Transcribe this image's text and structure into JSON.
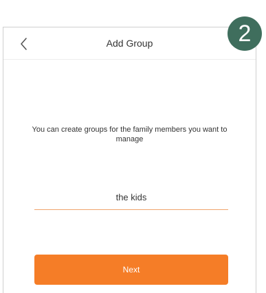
{
  "header": {
    "title": "Add Group"
  },
  "main": {
    "description": "You can create groups for the family members you want to manage",
    "group_name_value": "the kids",
    "next_label": "Next"
  },
  "step_badge": "2",
  "colors": {
    "accent": "#f57d27",
    "badge": "#3f6e5d"
  },
  "icons": {
    "back": "chevron-left-icon"
  }
}
